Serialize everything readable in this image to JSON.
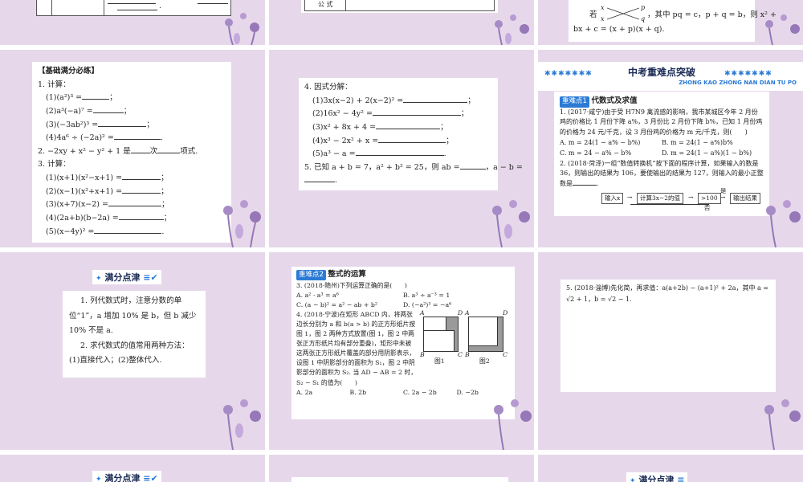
{
  "slide1": {
    "table_row_blank": "."
  },
  "slide2": {
    "table_cell": "公 式"
  },
  "slide3": {
    "line1_prefix": "若",
    "line1_mid": "，其中 pq = c，p + q = b，则 x² +",
    "line2": "bx + c = (x + p)(x + q).",
    "cross_x1": "x",
    "cross_x2": "x",
    "cross_p": "p",
    "cross_q": "q"
  },
  "slide4": {
    "heading": "【基础满分必练】",
    "q1": "1. 计算：",
    "q1_items": [
      "(1)(a²)³ =",
      "(2)a³(−a)⁷ =",
      "(3)(−3ab²)³ =",
      "(4)4a⁶ ÷ (−2a)² ="
    ],
    "q2_a": "2. −2xy + x² − y² + 1 是",
    "q2_b": "次",
    "q2_c": "项式.",
    "q3": "3. 计算：",
    "q3_items": [
      "(1)(x+1)(x²−x+1) =",
      "(2)(x−1)(x²+x+1) =",
      "(3)(x+7)(x−2) =",
      "(4)(2a+b)(b−2a) =",
      "(5)(x−4y)² ="
    ],
    "semicolon": "；",
    "period": "."
  },
  "slide5": {
    "q4": "4. 因式分解：",
    "q4_items": [
      "(1)3x(x−2) + 2(x−2)² =",
      "(2)16x² − 4y² =",
      "(3)x² + 8x + 4 =",
      "(4)x³ − 2x² + x =",
      "(5)a³ − a ="
    ],
    "q5_a": "5. 已知 a + b = 7，a² + b² = 25，则 ab =",
    "q5_b": "，a − b =",
    "semicolon": "；",
    "period": "."
  },
  "slide6": {
    "title_cn": "中考重难点突破",
    "title_pinyin": "ZHONG KAO ZHONG NAN DIAN TU PO",
    "tag": "重难点1",
    "subtitle": "代数式及求值",
    "q1": "1. (2017·咸宁)由于受 H7N9 禽流感的影响，我市某城区今年 2 月份鸡的价格比 1 月份下降 a%，3 月份比 2 月份下降 b%，已知 1 月份鸡的价格为 24 元/千克，设 3 月份鸡的价格为 m 元/千克，则(　　)",
    "q1_opts": [
      "A. m = 24(1 − a% − b%)",
      "B. m = 24(1 − a%)b%",
      "C. m = 24 − a% − b%",
      "D. m = 24(1 − a%)(1 − b%)"
    ],
    "q2": "2. (2018·菏泽)一组“数值转换机”按下面的程序计算，如果输入的数是 36，则输出的结果为 106，要使输出的结果为 127，则输入的最小正整数是",
    "q2_end": ".",
    "flow": [
      "输入x",
      "计算3x−2的值",
      ">100",
      "输出结果"
    ],
    "flow_yes": "是",
    "flow_no": "否"
  },
  "slide7": {
    "badge": "满分点津",
    "tip1": "1. 列代数式时，注意分数的单位“1”，a 增加 10% 是 b，但 b 减少 10% 不是 a.",
    "tip2": "2. 求代数式的值常用两种方法：(1)直接代入；(2)整体代入."
  },
  "slide8": {
    "tag": "重难点2",
    "subtitle": "整式的运算",
    "q3": "3. (2018·随州)下列运算正确的是(　　)",
    "q3_opts": [
      "A. a² · a³ = a⁶",
      "B. a³ ÷ a⁻³ = 1",
      "C. (a − b)² = a² − ab + b²",
      "D. (−a²)³ = −a⁶"
    ],
    "q4": "4. (2018·宁波)在矩形 ABCD 内，将两张边长分别为 a 和 b(a > b) 的正方形纸片按图 1，图 2 两种方式放置(图 1，图 2 中两张正方形纸片均有部分重叠)，矩形中未被这两张正方形纸片覆盖的部分用阴影表示，设图 1 中阴影部分的面积为 S₁，图 2 中阴影部分的面积为 S₂. 当 AD − AB = 2 时，S₂ − S₁ 的值为(　　)",
    "q4_opts": [
      "A. 2a",
      "B. 2b",
      "C. 2a − 2b",
      "D. −2b"
    ],
    "fig1": "图1",
    "fig2": "图2",
    "labels": [
      "A",
      "D",
      "B",
      "C",
      "A",
      "D",
      "B",
      "C"
    ]
  },
  "slide9": {
    "q5": "5. (2018·淄博)先化简，再求值：a(a+2b) − (a+1)² + 2a，其中 a = √2 + 1，b = √2 − 1."
  },
  "slide10": {
    "badge": "满分点津"
  },
  "slide12": {
    "badge": "满分点津"
  }
}
